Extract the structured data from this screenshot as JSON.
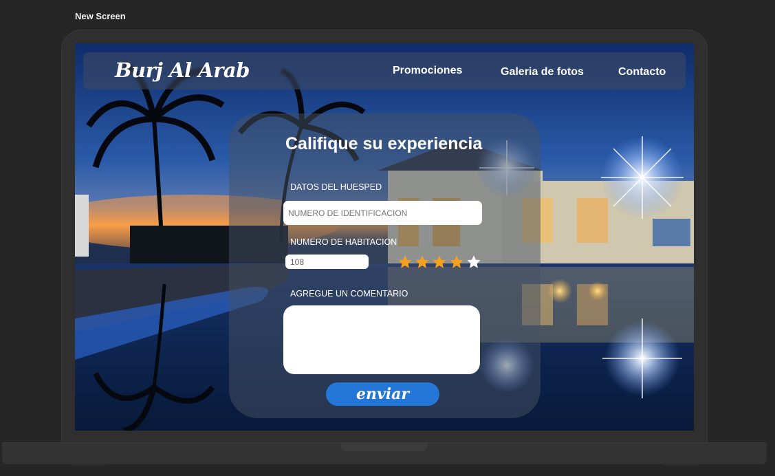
{
  "editor": {
    "frame_label": "New Screen"
  },
  "header": {
    "brand": "Burj Al Arab",
    "nav": [
      {
        "label": "Promociones"
      },
      {
        "label": "Galeria de fotos"
      },
      {
        "label": "Contacto"
      }
    ]
  },
  "form": {
    "title": "Califique su experiencia",
    "guest_label": "DATOS DEL HUESPED",
    "id_placeholder": "NUMERO DE IDENTIFICACION",
    "room_label": "NUMERO DE HABITACION",
    "room_value": "108",
    "rating": {
      "value": 4,
      "max": 5,
      "filled_color": "#f4a020",
      "empty_color": "#ffffff"
    },
    "comment_label": "AGREGUE UN COMENTARIO",
    "comment_value": "",
    "submit_label": "enviar"
  },
  "colors": {
    "accent": "#2477d6",
    "page_bg": "#262626"
  }
}
